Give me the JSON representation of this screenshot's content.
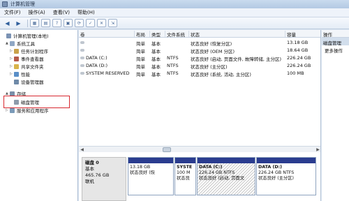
{
  "window": {
    "title": "计算机管理"
  },
  "menu": [
    "文件(F)",
    "操作(A)",
    "查看(V)",
    "帮助(H)"
  ],
  "tree": [
    {
      "label": "计算机管理(本地)",
      "arrow": "",
      "color": "#7b93b4"
    },
    {
      "label": "系统工具",
      "arrow": "▲",
      "color": "#8fa7c4"
    },
    {
      "label": "任务计划程序",
      "arrow": "▷",
      "color": "#c9a24a"
    },
    {
      "label": "事件查看器",
      "arrow": "▷",
      "color": "#b55a4a"
    },
    {
      "label": "共享文件夹",
      "arrow": "▷",
      "color": "#d8b34a"
    },
    {
      "label": "性能",
      "arrow": "▷",
      "color": "#5a8fc7"
    },
    {
      "label": "设备管理器",
      "arrow": "",
      "color": "#6f8aa8"
    },
    {
      "label": "存储",
      "arrow": "▲",
      "color": "#7a8fa8"
    },
    {
      "label": "磁盘管理",
      "arrow": "",
      "color": "#8e9bab"
    },
    {
      "label": "服务和应用程序",
      "arrow": "▷",
      "color": "#7a9ab8"
    }
  ],
  "volume_list": {
    "headers": [
      "卷",
      "布局",
      "类型",
      "文件系统",
      "状态",
      "容量"
    ],
    "rows": [
      {
        "vol": "",
        "layout": "简单",
        "type": "基本",
        "fs": "",
        "status": "状态良好 (恢复分区)",
        "cap": "13.18 GB"
      },
      {
        "vol": "",
        "layout": "简单",
        "type": "基本",
        "fs": "",
        "status": "状态良好 (OEM 分区)",
        "cap": "18.64 GB"
      },
      {
        "vol": "DATA (C:)",
        "layout": "简单",
        "type": "基本",
        "fs": "NTFS",
        "status": "状态良好 (启动, 页面文件, 故障转储, 主分区)",
        "cap": "226.24 GB"
      },
      {
        "vol": "DATA (D:)",
        "layout": "简单",
        "type": "基本",
        "fs": "NTFS",
        "status": "状态良好 (主分区)",
        "cap": "226.24 GB"
      },
      {
        "vol": "SYSTEM RESERVED",
        "layout": "简单",
        "type": "基本",
        "fs": "NTFS",
        "status": "状态良好 (系统, 活动, 主分区)",
        "cap": "100 MB"
      }
    ]
  },
  "disk": {
    "name": "磁盘 0",
    "type": "基本",
    "size": "465.76 GB",
    "state": "联机",
    "partitions": [
      {
        "name": "",
        "size": "13.18 GB",
        "status": "状态良好 (恢"
      },
      {
        "name": "SYSTE",
        "size": "100 M",
        "status": "状态良"
      },
      {
        "name": "DATA  (C:)",
        "size": "226.24 GB NTFS",
        "status": "状态良好 (启动, 页面文"
      },
      {
        "name": "DATA  (D:)",
        "size": "226.24 GB NTFS",
        "status": "状态良好 (主分区)"
      }
    ]
  },
  "actions": {
    "header": "操作",
    "section": "磁盘管理",
    "more": "更多操作"
  }
}
